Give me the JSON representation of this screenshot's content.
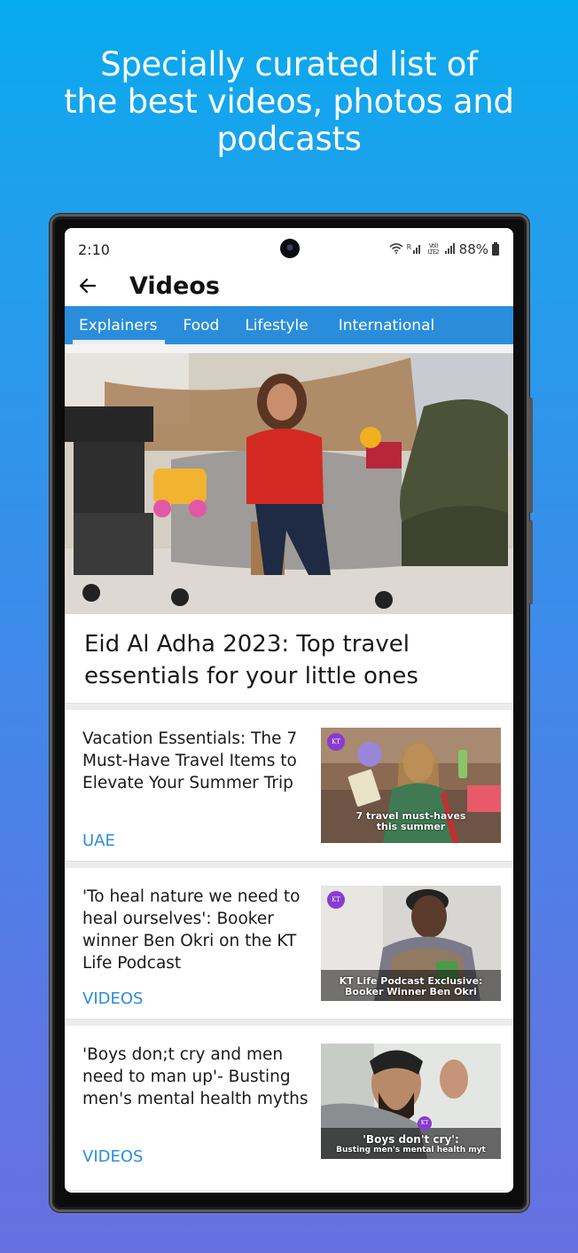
{
  "promo": {
    "headline_lines": [
      "Specially curated list of",
      "the best videos, photos and",
      "podcasts"
    ]
  },
  "statusbar": {
    "time": "2:10",
    "icons": [
      "wifi-icon",
      "signal-r-icon",
      "volte-lte2-icon",
      "signal-icon"
    ],
    "signal_r_label": "R",
    "volte_label": "Vo)) LTE2",
    "battery": "88%"
  },
  "appbar": {
    "back_icon": "arrow-left-icon",
    "title": "Videos"
  },
  "tabs": [
    {
      "label": "Explainers",
      "active": true
    },
    {
      "label": "Food",
      "active": false
    },
    {
      "label": "Lifestyle",
      "active": false
    },
    {
      "label": "International",
      "active": false
    }
  ],
  "colors": {
    "accent": "#2a8ddb",
    "category": "#2a8ddb",
    "text": "#1a1a1a",
    "kt_badge": "#8a3ad0"
  },
  "hero": {
    "image_description": "Woman in red top seated on bench among strollers and baby toys",
    "title": "Eid Al Adha 2023: Top travel essentials for your little ones"
  },
  "articles": [
    {
      "headline": "Vacation Essentials: The 7 Must-Have Travel Items to Elevate Your Summer Trip",
      "category": "UAE",
      "thumb_caption": [
        "7 travel must-haves",
        "this summer"
      ],
      "thumb_badge": "KT"
    },
    {
      "headline": "'To heal nature we need to heal ourselves': Booker winner Ben Okri on the KT Life Podcast",
      "category": "VIDEOS",
      "thumb_caption": [
        "KT Life Podcast Exclusive:",
        "Booker Winner Ben Okri"
      ],
      "thumb_badge": "KT"
    },
    {
      "headline": "'Boys don;t cry and men need to man up'- Busting men's mental health myths",
      "category": "VIDEOS",
      "thumb_caption": [
        "'Boys don't cry':",
        "Busting men's mental health myt"
      ],
      "thumb_badge": "KT"
    }
  ]
}
